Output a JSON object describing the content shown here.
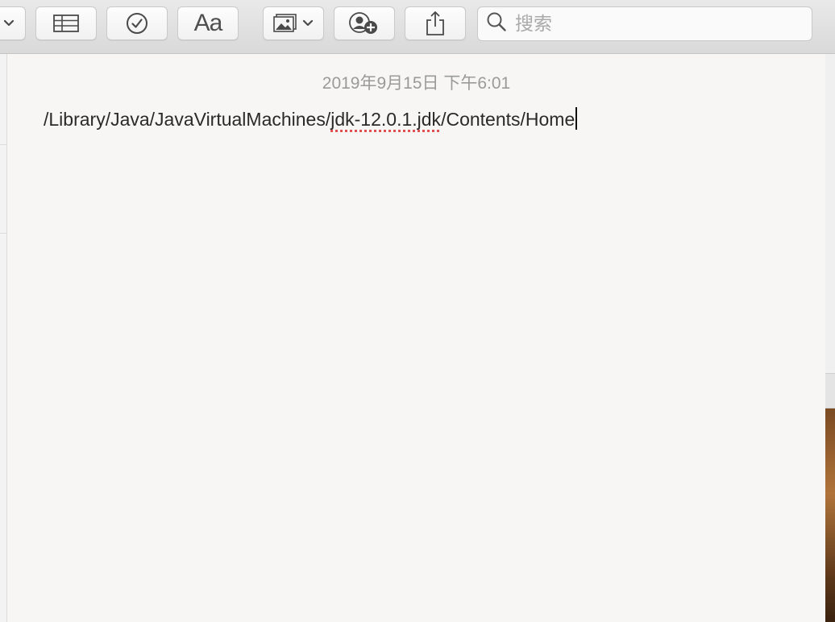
{
  "toolbar": {
    "buttons": [
      {
        "name": "view-dropdown-button",
        "icon": "chevron-down-icon"
      },
      {
        "name": "table-button",
        "icon": "table-icon"
      },
      {
        "name": "checklist-button",
        "icon": "checkmark-circle-icon"
      },
      {
        "name": "format-button",
        "icon": "text-format-icon",
        "label": "Aa"
      },
      {
        "name": "media-button",
        "icon": "photo-icon"
      },
      {
        "name": "collaborate-button",
        "icon": "add-person-icon"
      },
      {
        "name": "share-button",
        "icon": "share-icon"
      }
    ],
    "search": {
      "placeholder": "搜索",
      "value": ""
    }
  },
  "note": {
    "date": "2019年9月15日 下午6:01",
    "text_before": "/Library/Java/JavaVirtualMachines/",
    "text_misspelled": "jdk-12.0.1.jdk",
    "text_after": "/Contents/Home"
  },
  "colors": {
    "note_background": "#f7f6f4",
    "toolbar_background": "#dcdcdc",
    "spell_underline": "#e05252",
    "date_text": "#9a9a9a"
  }
}
